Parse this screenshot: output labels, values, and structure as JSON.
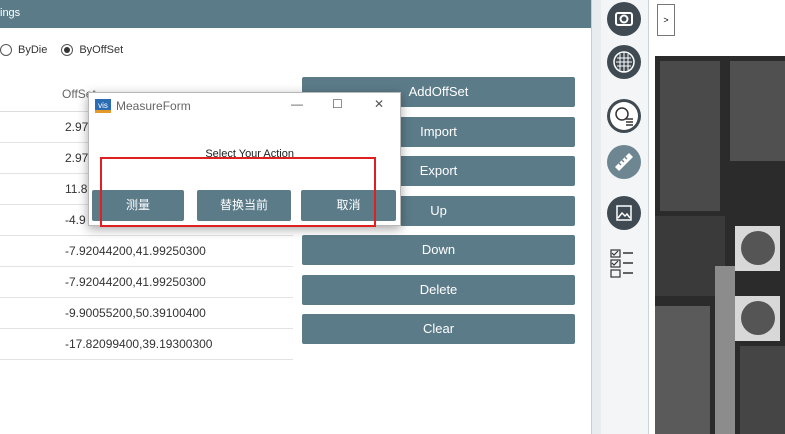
{
  "header": {
    "title": "ings"
  },
  "radios": [
    {
      "label": "ByDie",
      "selected": false
    },
    {
      "label": "ByOffSet",
      "selected": true
    }
  ],
  "table": {
    "header": "OffSet",
    "rows": [
      "2.97",
      "2.97",
      "11.8",
      "-4.9",
      "-7.92044200,41.99250300",
      "-7.92044200,41.99250300",
      "-9.90055200,50.39100400",
      "-17.82099400,39.19300300"
    ]
  },
  "buttons": [
    "AddOffSet",
    "Import",
    "Export",
    "Up",
    "Down",
    "Delete",
    "Clear"
  ],
  "dialog": {
    "title": "MeasureForm",
    "logo": "vis",
    "minimize": "—",
    "maximize": "☐",
    "close": "✕",
    "message": "Select Your Action",
    "btn_measure": "测量",
    "btn_replace": "替换当前",
    "btn_cancel": "取消"
  },
  "right": {
    "top_box": ">"
  },
  "colors": {
    "accent": "#5b7b89",
    "highlight": "#e02020"
  },
  "icons": [
    "camera-icon",
    "wafer-grid-icon",
    "die-list-icon",
    "measure-ruler-icon",
    "image-icon",
    "checklist-icon"
  ]
}
